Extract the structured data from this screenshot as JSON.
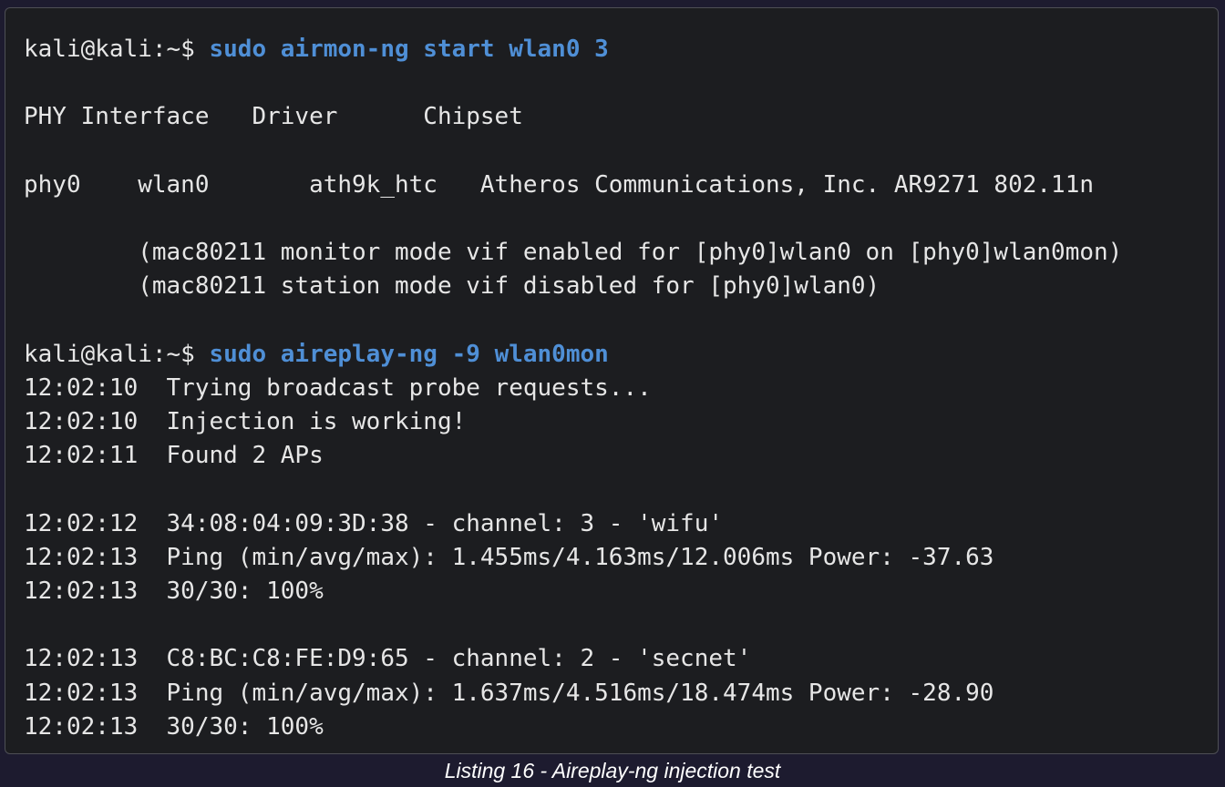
{
  "terminal": {
    "prompt": "kali@kali:~$ ",
    "commands": [
      "sudo airmon-ng start wlan0 3",
      "sudo aireplay-ng -9 wlan0mon"
    ],
    "airmon_output": [
      "PHY Interface   Driver      Chipset",
      "phy0    wlan0       ath9k_htc   Atheros Communications, Inc. AR9271 802.11n",
      "        (mac80211 monitor mode vif enabled for [phy0]wlan0 on [phy0]wlan0mon)",
      "        (mac80211 station mode vif disabled for [phy0]wlan0)"
    ],
    "aireplay_output": [
      "12:02:10  Trying broadcast probe requests...",
      "12:02:10  Injection is working!",
      "12:02:11  Found 2 APs",
      "12:02:12  34:08:04:09:3D:38 - channel: 3 - 'wifu'",
      "12:02:13  Ping (min/avg/max): 1.455ms/4.163ms/12.006ms Power: -37.63",
      "12:02:13  30/30: 100%",
      "12:02:13  C8:BC:C8:FE:D9:65 - channel: 2 - 'secnet'",
      "12:02:13  Ping (min/avg/max): 1.637ms/4.516ms/18.474ms Power: -28.90",
      "12:02:13  30/30: 100%"
    ]
  },
  "caption": "Listing 16 - Aireplay-ng injection test",
  "colors": {
    "background": "#1d1b2f",
    "terminal_bg": "#1c1d20",
    "command": "#4f8fd6",
    "text": "#e6e6e6"
  }
}
